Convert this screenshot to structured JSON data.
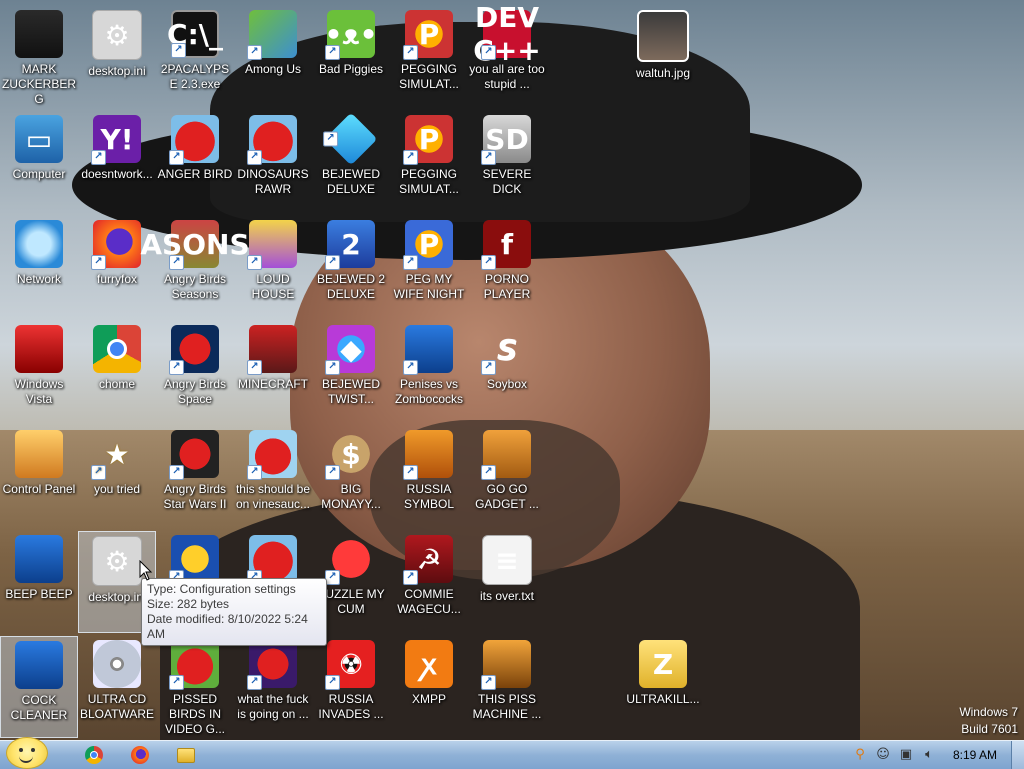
{
  "desktop": {
    "icons": [
      {
        "label": "MARK ZUCKERBERG",
        "icon": "person-photo-icon",
        "art": "art-person",
        "glyph": "",
        "shortcut": false
      },
      {
        "label": "desktop.ini",
        "icon": "config-file-icon",
        "art": "art-ini",
        "glyph": "⚙",
        "shortcut": false
      },
      {
        "label": "2PACALYPSE 2.3.exe",
        "icon": "command-prompt-icon",
        "art": "art-cmd",
        "glyph": "C:\\_",
        "shortcut": true
      },
      {
        "label": "Among Us",
        "icon": "among-us-icon",
        "art": "art-among",
        "glyph": "",
        "shortcut": true
      },
      {
        "label": "Bad Piggies",
        "icon": "bad-piggies-icon",
        "art": "art-piggy",
        "glyph": "•ᴥ•",
        "shortcut": true
      },
      {
        "label": "PEGGING SIMULAT...",
        "icon": "p-logo-icon",
        "art": "art-peg",
        "glyph": "P",
        "shortcut": true
      },
      {
        "label": "you all are too stupid ...",
        "icon": "dev-cpp-icon",
        "art": "art-dev",
        "glyph": "DEV C++",
        "shortcut": true
      },
      {
        "label": "waltuh.jpg",
        "icon": "image-file-icon",
        "art": "art-photo",
        "glyph": "",
        "shortcut": false
      },
      {
        "label": "Computer",
        "icon": "computer-icon",
        "art": "art-computer",
        "glyph": "▭",
        "shortcut": false
      },
      {
        "label": "doesntwork...",
        "icon": "yahoo-messenger-icon",
        "art": "art-yahoo",
        "glyph": "Y!",
        "shortcut": true
      },
      {
        "label": "ANGER BIRD",
        "icon": "angry-birds-icon",
        "art": "art-angry",
        "glyph": "",
        "shortcut": true
      },
      {
        "label": "DINOSAURS RAWR",
        "icon": "angry-birds-icon",
        "art": "art-angry",
        "glyph": "",
        "shortcut": true
      },
      {
        "label": "BEJEWED DELUXE",
        "icon": "diamond-icon",
        "art": "art-diamond",
        "glyph": "",
        "shortcut": true
      },
      {
        "label": "PEGGING SIMULAT...",
        "icon": "p-logo-icon",
        "art": "art-peg",
        "glyph": "P",
        "shortcut": true
      },
      {
        "label": "SEVERE DICK",
        "icon": "sd-gear-icon",
        "art": "art-sd",
        "glyph": "SD",
        "shortcut": true
      },
      {
        "label": "Network",
        "icon": "network-globe-icon",
        "art": "art-network",
        "glyph": "",
        "shortcut": false
      },
      {
        "label": "furryfox",
        "icon": "firefox-icon",
        "art": "art-firefox",
        "glyph": "",
        "shortcut": true
      },
      {
        "label": "Angry Birds Seasons",
        "icon": "angry-birds-seasons-icon",
        "art": "art-seasons",
        "glyph": "ASONS",
        "shortcut": true
      },
      {
        "label": "LOUD HOUSE",
        "icon": "angry-bird-hat-icon",
        "art": "art-loud",
        "glyph": "",
        "shortcut": true
      },
      {
        "label": "BEJEWED 2 DELUXE",
        "icon": "bejeweled-2-icon",
        "art": "art-bej2",
        "glyph": "2",
        "shortcut": true
      },
      {
        "label": "PEG MY WIFE NIGHT",
        "icon": "p-logo-icon",
        "art": "art-pegwife",
        "glyph": "P",
        "shortcut": true
      },
      {
        "label": "PORNO PLAYER",
        "icon": "flash-player-icon",
        "art": "art-flash",
        "glyph": "f",
        "shortcut": true
      },
      {
        "label": "Windows Vista",
        "icon": "recycle-bin-icon",
        "art": "art-bin",
        "glyph": "",
        "shortcut": false
      },
      {
        "label": "chome",
        "icon": "chrome-icon",
        "art": "art-chrome",
        "glyph": "",
        "shortcut": false
      },
      {
        "label": "Angry Birds Space",
        "icon": "angry-birds-space-icon",
        "art": "art-space",
        "glyph": "",
        "shortcut": true
      },
      {
        "label": "MINECRAFT",
        "icon": "minecraft-bird-icon",
        "art": "art-mine",
        "glyph": "",
        "shortcut": true
      },
      {
        "label": "BEJEWED TWIST...",
        "icon": "bejeweled-twist-icon",
        "art": "art-twist",
        "glyph": "◆",
        "shortcut": true
      },
      {
        "label": "Penises vs Zombococks",
        "icon": "blue-slab-icon",
        "art": "art-penises",
        "glyph": "",
        "shortcut": true
      },
      {
        "label": "Soybox",
        "icon": "soybox-s-icon",
        "art": "art-soybox",
        "glyph": "S",
        "shortcut": true
      },
      {
        "label": "Control Panel",
        "icon": "control-panel-icon",
        "art": "art-control",
        "glyph": "",
        "shortcut": false
      },
      {
        "label": "you tried",
        "icon": "gold-star-icon",
        "art": "art-star",
        "glyph": "★",
        "shortcut": true
      },
      {
        "label": "Angry Birds Star Wars II",
        "icon": "angry-birds-star-wars-icon",
        "art": "art-sw",
        "glyph": "",
        "shortcut": true
      },
      {
        "label": "this should be on vinesauc...",
        "icon": "angry-birds-icon",
        "art": "art-vine",
        "glyph": "",
        "shortcut": true
      },
      {
        "label": "BIG MONAYY...",
        "icon": "money-bag-icon",
        "art": "art-money",
        "glyph": "$",
        "shortcut": true
      },
      {
        "label": "RUSSIA SYMBOL",
        "icon": "orange-block-icon",
        "art": "art-russia",
        "glyph": "",
        "shortcut": true
      },
      {
        "label": "GO GO GADGET ...",
        "icon": "briefcase-icon",
        "art": "art-gadget",
        "glyph": "",
        "shortcut": true
      },
      {
        "label": "BEEP BEEP",
        "icon": "blue-slab-icon",
        "art": "art-beep",
        "glyph": "",
        "shortcut": false
      },
      {
        "label": "desktop.ini",
        "icon": "config-file-icon",
        "art": "art-ini",
        "glyph": "⚙",
        "shortcut": false
      },
      {
        "label": "",
        "icon": "angry-birds-star-wars-icon",
        "art": "art-cstar",
        "glyph": "",
        "shortcut": true
      },
      {
        "label": "",
        "icon": "angry-birds-icon",
        "art": "art-angry",
        "glyph": "",
        "shortcut": true
      },
      {
        "label": "PUZZLE MY CUM",
        "icon": "red-fuzzball-icon",
        "art": "art-puzzle",
        "glyph": "",
        "shortcut": true
      },
      {
        "label": "COMMIE WAGECU...",
        "icon": "commie-logo-icon",
        "art": "art-commie",
        "glyph": "☭",
        "shortcut": true
      },
      {
        "label": "its over.txt",
        "icon": "text-file-icon",
        "art": "art-txt",
        "glyph": "≡",
        "shortcut": false
      },
      {
        "label": "COCK CLEANER",
        "icon": "blue-slab-icon",
        "art": "art-beep",
        "glyph": "",
        "shortcut": false
      },
      {
        "label": "ULTRA CD BLOATWARE",
        "icon": "cd-disc-icon",
        "art": "art-cd",
        "glyph": "",
        "shortcut": false
      },
      {
        "label": "PISSED BIRDS IN VIDEO G...",
        "icon": "angry-birds-icon",
        "art": "art-pissed",
        "glyph": "",
        "shortcut": true
      },
      {
        "label": "what the fuck is going on ...",
        "icon": "angry-birds-space-icon",
        "art": "art-wtf",
        "glyph": "",
        "shortcut": true
      },
      {
        "label": "RUSSIA INVADES ...",
        "icon": "radiation-icon",
        "art": "art-nuke",
        "glyph": "☢",
        "shortcut": true
      },
      {
        "label": "XMPP",
        "icon": "xampp-icon",
        "art": "art-xmpp",
        "glyph": "ꭗ",
        "shortcut": false
      },
      {
        "label": "THIS PISS MACHINE ...",
        "icon": "media-box-icon",
        "art": "art-machine",
        "glyph": "",
        "shortcut": true
      },
      {
        "label": "ULTRAKILL...",
        "icon": "zip-folder-icon",
        "art": "art-zip",
        "glyph": "Z",
        "shortcut": false
      }
    ]
  },
  "tooltip": {
    "type": "Type: Configuration settings",
    "size": "Size: 282 bytes",
    "modified": "Date modified: 8/10/2022 5:24 AM"
  },
  "watermark": {
    "line1": "Windows 7",
    "line2": "Build 7601"
  },
  "taskbar": {
    "clock": "8:19 AM",
    "pinned": [
      {
        "icon": "chrome-icon"
      },
      {
        "icon": "firefox-icon"
      },
      {
        "icon": "folder-icon"
      }
    ]
  }
}
